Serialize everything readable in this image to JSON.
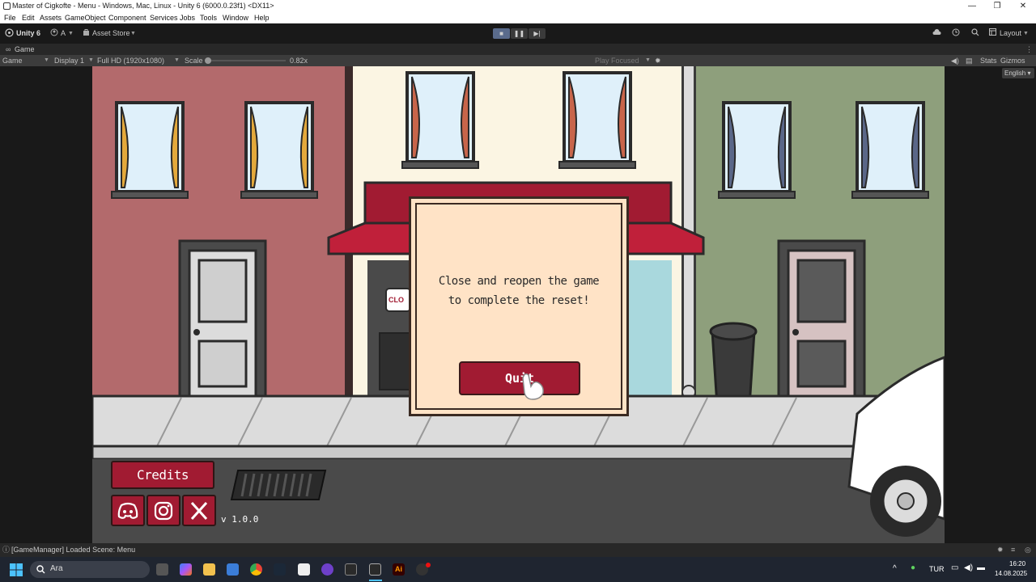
{
  "window": {
    "title": "Master of Cigkofte - Menu - Windows, Mac, Linux - Unity 6 (6000.0.23f1) <DX11>",
    "controls": [
      "—",
      "❐",
      "✕"
    ]
  },
  "menubar": {
    "items": [
      "File",
      "Edit",
      "Assets",
      "GameObject",
      "Component",
      "Services",
      "Jobs",
      "Tools",
      "Window",
      "Help"
    ]
  },
  "toolbar": {
    "unity_label": "Unity 6",
    "account_label": "A",
    "asset_store_label": "Asset Store",
    "layout_label": "Layout"
  },
  "game_tab": {
    "label": "Game"
  },
  "gamebar": {
    "view_label": "Game",
    "display_label": "Display 1",
    "resolution_label": "Full HD (1920x1080)",
    "scale_label": "Scale",
    "scale_value": "0.82x",
    "play_focused_label": "Play Focused",
    "stats_label": "Stats",
    "gizmos_label": "Gizmos"
  },
  "language_dropdown": {
    "value": "English"
  },
  "dialog": {
    "message_line1": "Close and reopen the game",
    "message_line2": "to complete the reset!",
    "quit_label": "Quit"
  },
  "menu": {
    "credits_label": "Credits",
    "version": "v 1.0.0"
  },
  "shop_sign": {
    "closed_label": "CLO"
  },
  "console": {
    "message": "[GameManager] Loaded Scene: Menu"
  },
  "taskbar": {
    "search_placeholder": "Ara",
    "lang": "TUR",
    "time": "16:20",
    "date": "14.08.2025"
  },
  "colors": {
    "brand_red": "#a11b32",
    "dialog_bg": "#ffe3c6",
    "building_left": "#b36a6c",
    "building_mid": "#fbf5e3",
    "building_right": "#8e9f7c"
  }
}
